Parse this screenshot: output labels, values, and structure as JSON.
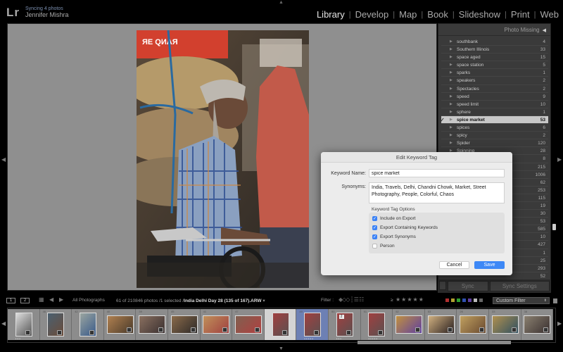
{
  "app": {
    "logo": "Lr",
    "sync_status": "Syncing 4 photos",
    "user_name": "Jennifer Mishra"
  },
  "modules": [
    {
      "label": "Library",
      "active": true
    },
    {
      "label": "Develop",
      "active": false
    },
    {
      "label": "Map",
      "active": false
    },
    {
      "label": "Book",
      "active": false
    },
    {
      "label": "Slideshow",
      "active": false
    },
    {
      "label": "Print",
      "active": false
    },
    {
      "label": "Web",
      "active": false
    }
  ],
  "right_panel": {
    "header": "Photo Missing",
    "header_icon": "triangle-left-icon",
    "keywords": [
      {
        "name": "southbank",
        "count": "4"
      },
      {
        "name": "Southern Illinois",
        "count": "33"
      },
      {
        "name": "space aged",
        "count": "15"
      },
      {
        "name": "space station",
        "count": "5"
      },
      {
        "name": "sparks",
        "count": "1"
      },
      {
        "name": "speakers",
        "count": "2"
      },
      {
        "name": "Spectacles",
        "count": "2"
      },
      {
        "name": "speed",
        "count": "9"
      },
      {
        "name": "speed limit",
        "count": "10"
      },
      {
        "name": "sphere",
        "count": "1"
      },
      {
        "name": "spice market",
        "count": "53",
        "selected": true
      },
      {
        "name": "spices",
        "count": "6"
      },
      {
        "name": "spicy",
        "count": "2"
      },
      {
        "name": "Spider",
        "count": "120"
      },
      {
        "name": "Spinning",
        "count": "28"
      },
      {
        "name": "",
        "count": "8"
      },
      {
        "name": "",
        "count": "215"
      },
      {
        "name": "",
        "count": "1006"
      },
      {
        "name": "",
        "count": "62"
      },
      {
        "name": "",
        "count": "253"
      },
      {
        "name": "",
        "count": "115"
      },
      {
        "name": "",
        "count": "19"
      },
      {
        "name": "",
        "count": "30"
      },
      {
        "name": "",
        "count": "53"
      },
      {
        "name": "",
        "count": "585"
      },
      {
        "name": "",
        "count": "10"
      },
      {
        "name": "",
        "count": "427"
      },
      {
        "name": "",
        "count": "1"
      },
      {
        "name": "",
        "count": "25"
      },
      {
        "name": "",
        "count": "293"
      },
      {
        "name": "",
        "count": "52"
      }
    ],
    "sync_label": "Sync",
    "sync_settings_label": "Sync Settings"
  },
  "dialog": {
    "title": "Edit Keyword Tag",
    "keyword_name_label": "Keyword Name:",
    "keyword_name_value": "spice market",
    "synonyms_label": "Synonyms:",
    "synonyms_value": "India, Travels, Delhi, Chandni Chowk, Market, Street Photography, People, Colorful, Chaos",
    "options_title": "Keyword Tag Options",
    "options": [
      {
        "label": "Include on Export",
        "checked": true
      },
      {
        "label": "Export Containing Keywords",
        "checked": true
      },
      {
        "label": "Export Synonyms",
        "checked": true
      },
      {
        "label": "Person",
        "checked": false
      }
    ],
    "cancel_label": "Cancel",
    "save_label": "Save"
  },
  "filmstrip_toolbar": {
    "screen1": "1",
    "screen2": "2",
    "source": "All Photographs",
    "count_text": "61 of 210846 photos /1 selected /",
    "filename": "India Delhi Day 28 (135 of 167).ARW",
    "filename_dropdown": "▾",
    "filter_label": "Filter :",
    "rating_op": "≥",
    "stars": "★★★★★",
    "color_labels": [
      "#b03030",
      "#b0a030",
      "#30a030",
      "#3050b0",
      "#6040a0",
      "#bbbbbb",
      "#666666"
    ],
    "custom_filter": "Custom Filter"
  },
  "filmstrip": {
    "cells": [
      {
        "num": "",
        "style": "normal",
        "thumb": "portrait",
        "colors": [
          "#ddd",
          "#555"
        ],
        "dots": "•••"
      },
      {
        "num": "46",
        "style": "normal",
        "thumb": "portrait",
        "colors": [
          "#4a6070",
          "#6b4c3a"
        ],
        "dots": ""
      },
      {
        "num": "42",
        "style": "normal",
        "thumb": "portrait",
        "colors": [
          "#9aa5a0",
          "#3a5a8a"
        ],
        "dots": ""
      },
      {
        "num": "40",
        "style": "normal",
        "thumb": "landscape",
        "colors": [
          "#b08050",
          "#4a3a2a"
        ],
        "dots": ""
      },
      {
        "num": "39",
        "style": "normal",
        "thumb": "landscape",
        "colors": [
          "#8a7060",
          "#3a3030"
        ],
        "dots": ""
      },
      {
        "num": "45",
        "style": "normal",
        "thumb": "landscape",
        "colors": [
          "#8a6a4a",
          "#2e2a28"
        ],
        "dots": ""
      },
      {
        "num": "41",
        "style": "normal",
        "thumb": "landscape",
        "colors": [
          "#c0905a",
          "#a04040"
        ],
        "dots": ""
      },
      {
        "num": "47",
        "style": "normal",
        "thumb": "landscape",
        "colors": [
          "#806050",
          "#b04040"
        ],
        "dots": ""
      },
      {
        "num": "",
        "style": "light",
        "thumb": "portrait",
        "colors": [
          "#a04040",
          "#5a5050"
        ],
        "dots": ""
      },
      {
        "num": "49",
        "style": "selected",
        "thumb": "portrait",
        "colors": [
          "#a04040",
          "#5a5050"
        ],
        "dots": "•••••"
      },
      {
        "num": "50",
        "style": "normal",
        "thumb": "portrait",
        "colors": [
          "#a04040",
          "#5a5050"
        ],
        "dots": "•••",
        "badge": "2"
      },
      {
        "num": "51",
        "style": "normal",
        "thumb": "portrait",
        "colors": [
          "#a04040",
          "#5a5050"
        ],
        "dots": "•••••"
      },
      {
        "num": "52",
        "style": "normal",
        "thumb": "landscape",
        "colors": [
          "#c09040",
          "#6040a0"
        ],
        "dots": ""
      },
      {
        "num": "53",
        "style": "normal",
        "thumb": "landscape",
        "colors": [
          "#d0b080",
          "#2a2020"
        ],
        "dots": ""
      },
      {
        "num": "26",
        "style": "normal",
        "thumb": "landscape",
        "colors": [
          "#c0a060",
          "#6a4a30"
        ],
        "dots": ""
      },
      {
        "num": "33",
        "style": "normal",
        "thumb": "landscape",
        "colors": [
          "#b09050",
          "#305060"
        ],
        "dots": ""
      },
      {
        "num": "38",
        "style": "normal",
        "thumb": "landscape",
        "colors": [
          "#8a8070",
          "#3a3030"
        ],
        "dots": ""
      }
    ]
  }
}
